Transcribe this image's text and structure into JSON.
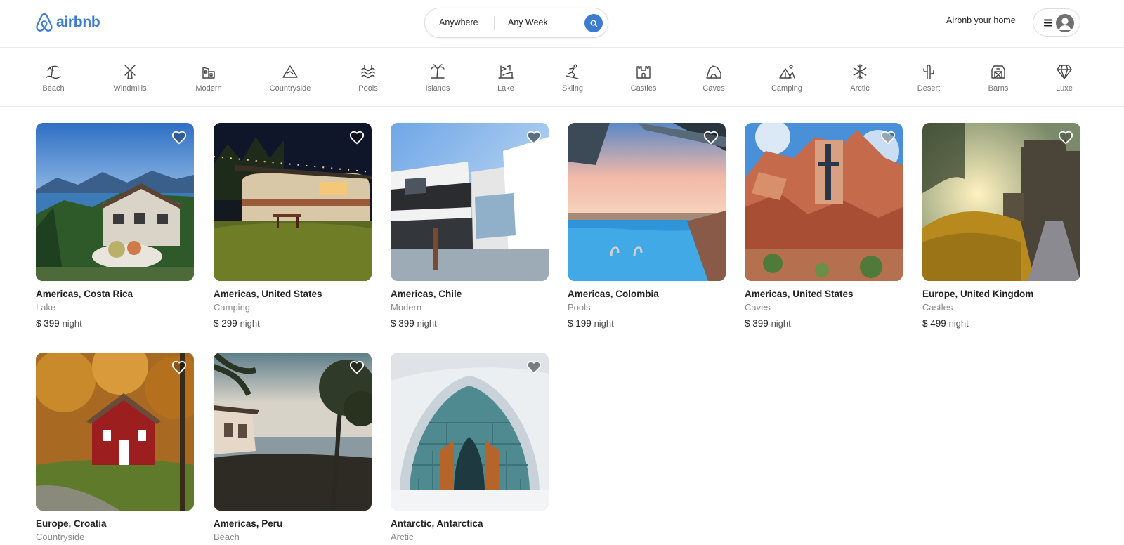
{
  "brand": {
    "name": "airbnb",
    "color": "#3b7bd0"
  },
  "search": {
    "where": "Anywhere",
    "week": "Any Week",
    "icon": "search-icon"
  },
  "header": {
    "host_link": "Airbnb your home",
    "menu_icon": "hamburger-icon",
    "avatar_icon": "user-avatar-icon"
  },
  "categories": [
    {
      "label": "Beach",
      "icon": "beach-icon"
    },
    {
      "label": "Windmills",
      "icon": "windmill-icon"
    },
    {
      "label": "Modern",
      "icon": "modern-house-icon"
    },
    {
      "label": "Countryside",
      "icon": "mountain-icon"
    },
    {
      "label": "Pools",
      "icon": "pool-icon"
    },
    {
      "label": "Islands",
      "icon": "palm-tree-icon"
    },
    {
      "label": "Lake",
      "icon": "lake-icon"
    },
    {
      "label": "Skiing",
      "icon": "skier-icon"
    },
    {
      "label": "Castles",
      "icon": "castle-icon"
    },
    {
      "label": "Caves",
      "icon": "cave-icon"
    },
    {
      "label": "Camping",
      "icon": "tent-icon"
    },
    {
      "label": "Arctic",
      "icon": "snowflake-icon"
    },
    {
      "label": "Desert",
      "icon": "cactus-icon"
    },
    {
      "label": "Barns",
      "icon": "barn-icon"
    },
    {
      "label": "Luxe",
      "icon": "diamond-icon"
    }
  ],
  "listings": [
    {
      "location": "Americas, Costa Rica",
      "category": "Lake",
      "price": "$ 399",
      "unit": "night"
    },
    {
      "location": "Americas, United States",
      "category": "Camping",
      "price": "$ 299",
      "unit": "night"
    },
    {
      "location": "Americas, Chile",
      "category": "Modern",
      "price": "$ 399",
      "unit": "night"
    },
    {
      "location": "Americas, Colombia",
      "category": "Pools",
      "price": "$ 199",
      "unit": "night"
    },
    {
      "location": "Americas, United States",
      "category": "Caves",
      "price": "$ 399",
      "unit": "night"
    },
    {
      "location": "Europe, United Kingdom",
      "category": "Castles",
      "price": "$ 499",
      "unit": "night"
    },
    {
      "location": "Europe, Croatia",
      "category": "Countryside",
      "price": "",
      "unit": ""
    },
    {
      "location": "Americas, Peru",
      "category": "Beach",
      "price": "",
      "unit": ""
    },
    {
      "location": "Antarctic, Antarctica",
      "category": "Arctic",
      "price": "",
      "unit": ""
    }
  ]
}
